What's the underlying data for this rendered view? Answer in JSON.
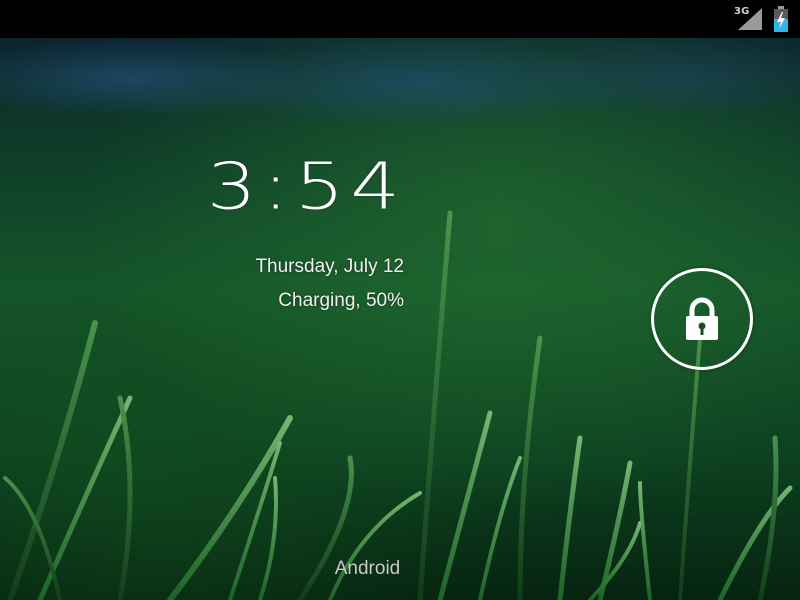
{
  "status_bar": {
    "network_type": "3G",
    "icons": [
      "signal-strength-icon",
      "battery-charging-icon"
    ],
    "battery_color": "#33b5e5"
  },
  "lockscreen": {
    "time": "3:54",
    "date": "Thursday, July 12",
    "charging_status": "Charging, 50%",
    "unlock_icon": "lock-icon",
    "carrier": "Android"
  },
  "colors": {
    "text": "#ffffff",
    "status_bar_bg": "#000000",
    "wallpaper_green": "#15552a"
  }
}
